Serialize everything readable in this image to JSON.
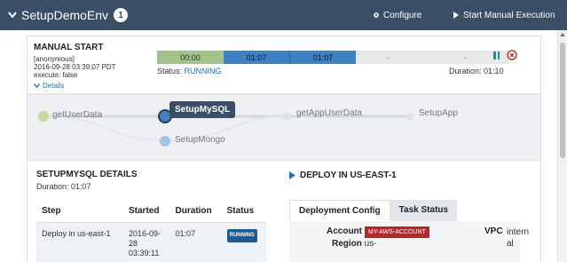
{
  "header": {
    "title": "SetupDemoEnv",
    "badge_count": "1",
    "configure_label": "Configure",
    "start_label": "Start Manual Execution"
  },
  "manual_start": {
    "label": "MANUAL START",
    "user": "[anonymous]",
    "timestamp": "2016-09-28 03:39:07 PDT",
    "execute": "execute: false",
    "details_label": "Details",
    "progress": [
      "00:00",
      "01:07",
      "01:07",
      "-",
      "-"
    ],
    "status_prefix": "Status: ",
    "status_value": "RUNNING",
    "duration": "Duration: 01:10"
  },
  "graph": {
    "nodes": {
      "get_user_data": "getUserData",
      "setup_mysql": "SetupMySQL",
      "get_app_user_data": "getAppUserData",
      "setup_app": "SetupApp",
      "setup_mongo": "SetupMongo"
    }
  },
  "details": {
    "title": "SETUPMYSQL DETAILS",
    "duration": "Duration: 01:07",
    "columns": [
      "Step",
      "Started",
      "Duration",
      "Status"
    ],
    "row": {
      "step": "Deploy in us-east-1",
      "started_line1": "2016-09-",
      "started_line2": "28",
      "started_line3": "03:39:11",
      "duration": "01:07",
      "status": "RUNNING"
    }
  },
  "deploy": {
    "title": "DEPLOY IN US-EAST-1",
    "tabs": [
      "Deployment Config",
      "Task Status"
    ],
    "account_label": "Account",
    "account_value": "MY-AWS-ACCOUNT",
    "region_label": "Region",
    "region_value": "us-",
    "vpc_label": "VPC",
    "vpc_value_1": "intern",
    "vpc_value_2": "al"
  },
  "colors": {
    "header_bg": "#3a4e66",
    "running_blue": "#3e82c2",
    "success_green": "#a3c38a",
    "account_red": "#b5282c"
  }
}
